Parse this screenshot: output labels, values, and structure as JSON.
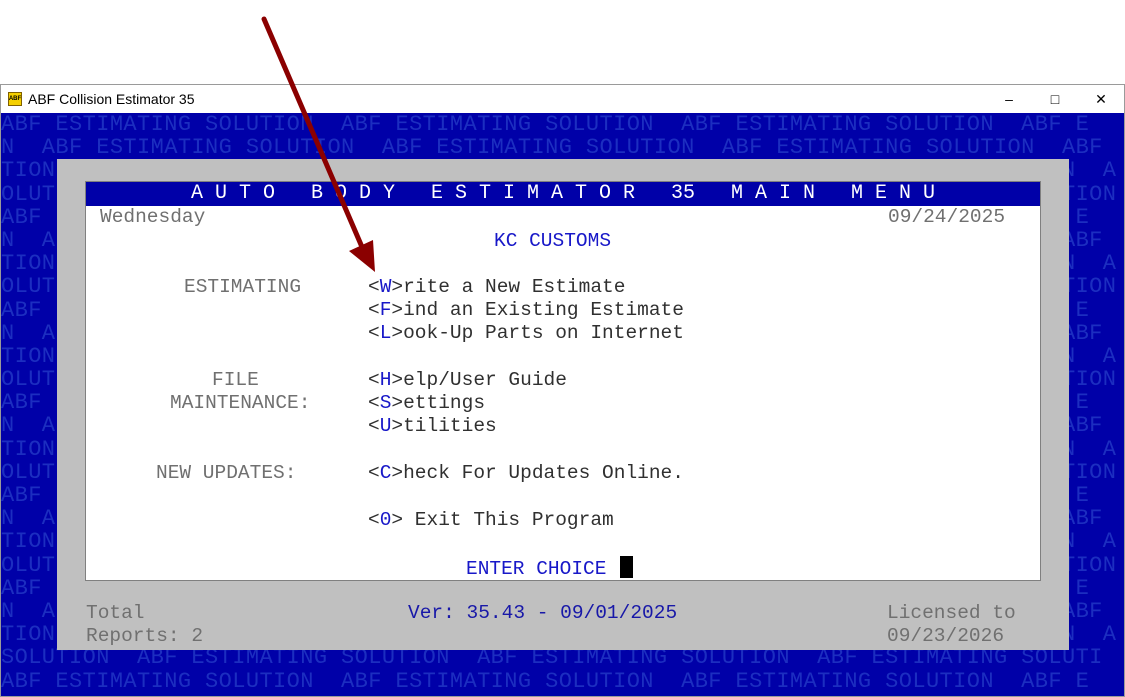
{
  "window": {
    "title": "ABF Collision Estimator 35",
    "icon_label": "ABF",
    "minimize": "–",
    "maximize": "□",
    "close": "✕"
  },
  "background": {
    "rows": [
      "ABF ESTIMATING SOLUTION  ABF ESTIMATING SOLUTION  ABF ESTIMATING SOLUTION  ABF E",
      "N  ABF ESTIMATING SOLUTION  ABF ESTIMATING SOLUTION  ABF ESTIMATING SOLUTION  ABF",
      "TION  ABF ESTIMATING SOLUTION  ABF ESTIMATING SOLUTION  ABF ESTIMATING SOLUTION  A",
      "OLUTION  ABF ESTIMATING SOLUTION  ABF ESTIMATING SOLUTION  ABF ESTIMATING SOLUTION",
      "ABF ESTIMATING SOLUTION  ABF ESTIMATING SOLUTION  ABF ESTIMATING SOLUTION  ABF E",
      "N  ABF ESTIMATING SOLUTION  ABF ESTIMATING SOLUTION  ABF ESTIMATING SOLUTION  ABF",
      "TION  ABF ESTIMATING SOLUTION  ABF ESTIMATING SOLUTION  ABF ESTIMATING SOLUTION  A",
      "OLUTION  ABF ESTIMATING SOLUTION  ABF ESTIMATING SOLUTION  ABF ESTIMATING SOLUTION",
      "ABF ESTIMATING SOLUTION  ABF ESTIMATING SOLUTION  ABF ESTIMATING SOLUTION  ABF E",
      "N  ABF ESTIMATING SOLUTION  ABF ESTIMATING SOLUTION  ABF ESTIMATING SOLUTION  ABF",
      "TION  ABF ESTIMATING SOLUTION  ABF ESTIMATING SOLUTION  ABF ESTIMATING SOLUTION  A",
      "OLUTION  ABF ESTIMATING SOLUTION  ABF ESTIMATING SOLUTION  ABF ESTIMATING SOLUTION",
      "ABF ESTIMATING SOLUTION  ABF ESTIMATING SOLUTION  ABF ESTIMATING SOLUTION  ABF E",
      "N  ABF ESTIMATING SOLUTION  ABF ESTIMATING SOLUTION  ABF ESTIMATING SOLUTION  ABF",
      "TION  ABF ESTIMATING SOLUTION  ABF ESTIMATING SOLUTION  ABF ESTIMATING SOLUTION  A",
      "OLUTION  ABF ESTIMATING SOLUTION  ABF ESTIMATING SOLUTION  ABF ESTIMATING SOLUTION",
      "ABF ESTIMATING SOLUTION  ABF ESTIMATING SOLUTION  ABF ESTIMATING SOLUTION  ABF E",
      "N  ABF ESTIMATING SOLUTION  ABF ESTIMATING SOLUTION  ABF ESTIMATING SOLUTION  ABF",
      "TION  ABF ESTIMATING SOLUTION  ABF ESTIMATING SOLUTION  ABF ESTIMATING SOLUTION  A",
      "OLUTION  ABF ESTIMATING SOLUTION  ABF ESTIMATING SOLUTION  ABF ESTIMATING SOLUTION",
      "ABF ESTIMATING SOLUTION  ABF ESTIMATING SOLUTION  ABF ESTIMATING SOLUTION  ABF E",
      "N  ABF ESTIMATING SOLUTION  ABF ESTIMATING SOLUTION  ABF ESTIMATING SOLUTION  ABF",
      "TION  ABF ESTIMATING SOLUTION  ABF ESTIMATING SOLUTION  ABF ESTIMATING SOLUTION  A",
      "SOLUTION  ABF ESTIMATING SOLUTION  ABF ESTIMATING SOLUTION  ABF ESTIMATING SOLUTI",
      "ABF ESTIMATING SOLUTION  ABF ESTIMATING SOLUTION  ABF ESTIMATING SOLUTION  ABF E"
    ]
  },
  "menu": {
    "header": "A U T O   B O D Y   E S T I M A T O R   35   M A I N   M E N U",
    "day": "Wednesday",
    "date": "09/24/2025",
    "company": "KC CUSTOMS",
    "sections": {
      "estimating": "ESTIMATING",
      "file": "FILE",
      "maintenance": "MAINTENANCE:",
      "updates": "NEW UPDATES:"
    },
    "items": {
      "write_key": "W",
      "write_rest": "rite a New Estimate",
      "find_key": "F",
      "find_rest": "ind an Existing Estimate",
      "lookup_key": "L",
      "lookup_rest": "ook-Up Parts on Internet",
      "help_key": "H",
      "help_rest": "elp/User Guide",
      "settings_key": "S",
      "settings_rest": "ettings",
      "utilities_key": "U",
      "utilities_rest": "tilities",
      "check_key": "C",
      "check_rest": "heck For Updates Online.",
      "exit_key": "0",
      "exit_rest": " Exit This Program"
    },
    "prompt": "ENTER CHOICE"
  },
  "footer": {
    "total": "Total",
    "reports": "Reports: 2",
    "version": "Ver: 35.43 - 09/01/2025",
    "licensed": "Licensed to",
    "license_date": "09/23/2026"
  },
  "colors": {
    "background_blue": "#0000a8",
    "background_text": "#1c2ec0",
    "panel_gray": "#c0c0c0",
    "key_blue": "#1818c8",
    "arrow": "#8b0000"
  }
}
